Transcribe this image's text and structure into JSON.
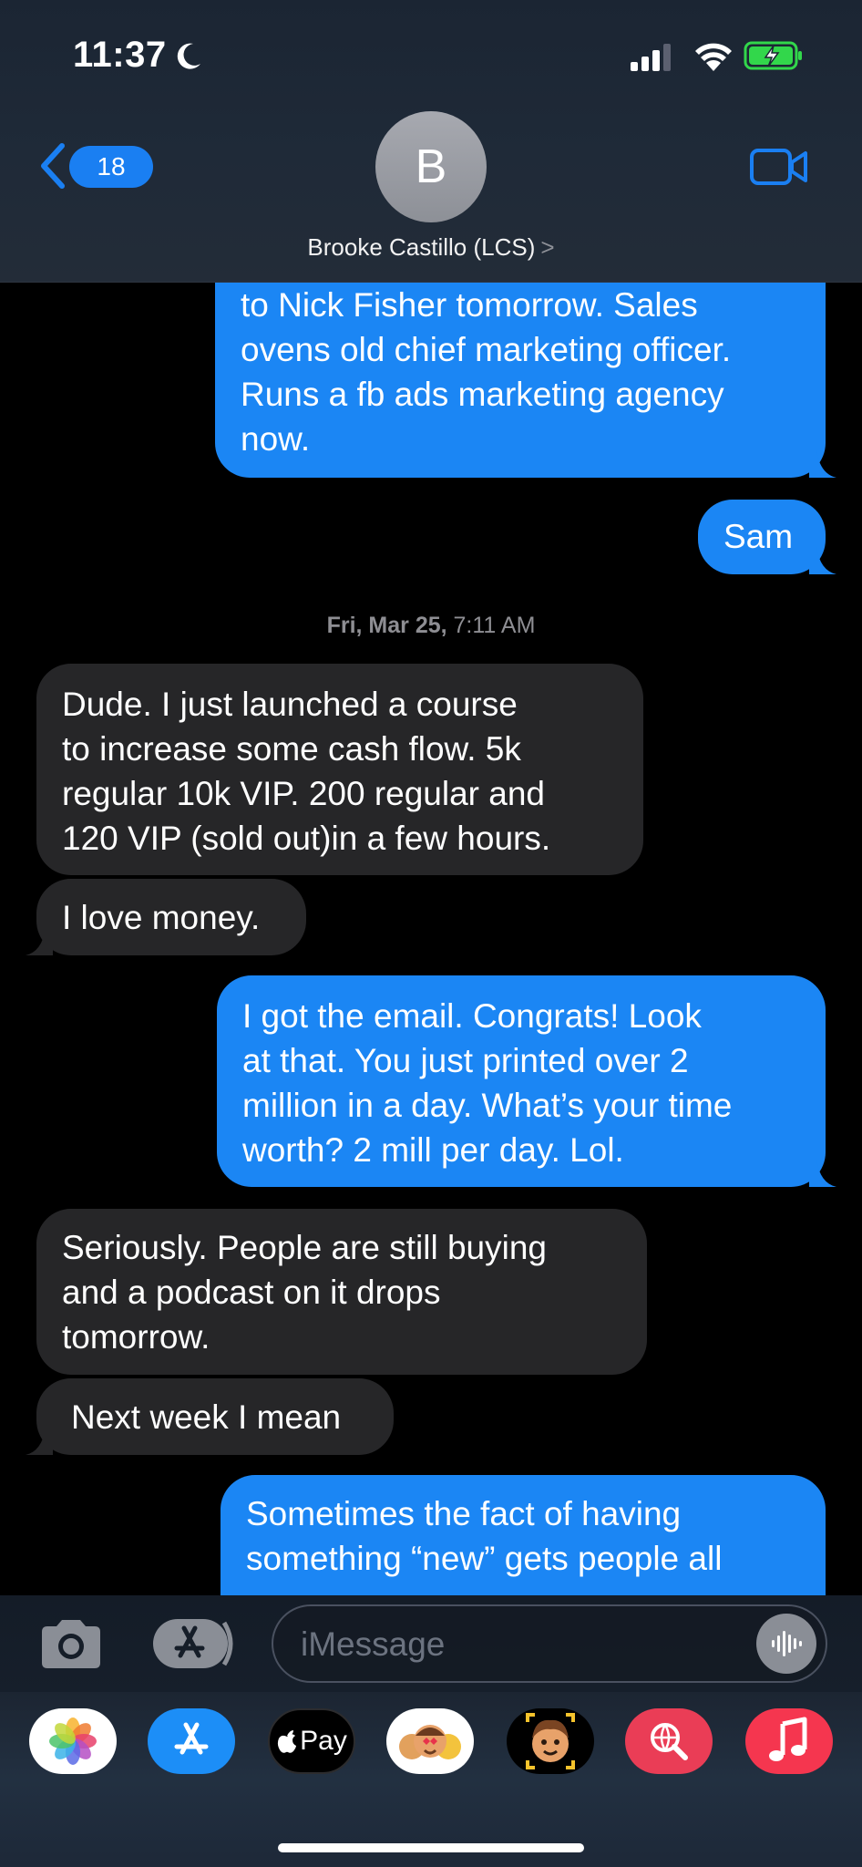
{
  "status_bar": {
    "time": "11:37"
  },
  "header": {
    "back_count": "18",
    "avatar_initial": "B",
    "contact_name": "Brooke Castillo (LCS)",
    "name_chevron": ">"
  },
  "messages": [
    {
      "direction": "outgoing",
      "text": "to Nick Fisher tomorrow. Sales\novens old chief marketing officer.\nRuns a fb ads marketing agency\nnow."
    },
    {
      "direction": "outgoing",
      "text": "Sam"
    },
    {
      "direction": "incoming",
      "text": "Dude.  I just launched a course\nto increase some cash flow.  5k\nregular 10k VIP.  200 regular and\n120 VIP (sold out)in a few hours."
    },
    {
      "direction": "incoming",
      "text": "I love money."
    },
    {
      "direction": "outgoing",
      "text": "I got the email. Congrats!  Look\nat that. You just printed over 2\nmillion in a day. What’s your time\nworth? 2 mill per day. Lol."
    },
    {
      "direction": "incoming",
      "text": "Seriously.  People are still buying\nand a podcast on it drops\ntomorrow."
    },
    {
      "direction": "incoming",
      "text": "Next week I mean"
    },
    {
      "direction": "outgoing",
      "text": "Sometimes the fact of having\nsomething “new” gets people all"
    }
  ],
  "timestamp": {
    "day": "Fri, Mar 25,",
    "time": "7:11 AM"
  },
  "input": {
    "placeholder": "iMessage"
  },
  "app_drawer": {
    "apps": [
      {
        "name": "photos-icon"
      },
      {
        "name": "app-store-icon"
      },
      {
        "name": "apple-pay-icon",
        "label": "Pay"
      },
      {
        "name": "memoji-stickers-icon"
      },
      {
        "name": "memoji-icon"
      },
      {
        "name": "web-images-icon"
      },
      {
        "name": "music-icon"
      }
    ]
  },
  "colors": {
    "outgoing_bubble": "#1b86f4",
    "incoming_bubble": "#262628",
    "accent": "#1a7ff2",
    "battery_green": "#32d74b"
  }
}
